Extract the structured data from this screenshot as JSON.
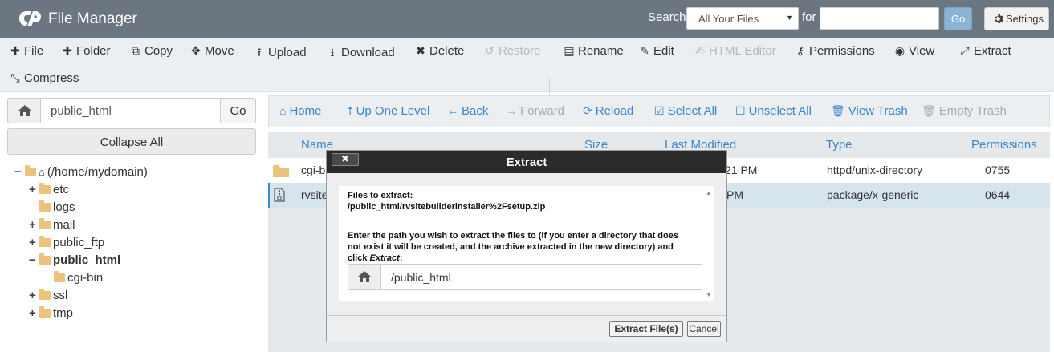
{
  "header": {
    "app_title": "File Manager",
    "search_label": "Search",
    "search_scope": "All Your Files",
    "for_label": "for",
    "search_value": "",
    "go_label": "Go",
    "settings_label": "Settings"
  },
  "toolbar": {
    "file": "File",
    "folder": "Folder",
    "copy": "Copy",
    "move": "Move",
    "upload": "Upload",
    "download": "Download",
    "delete": "Delete",
    "restore": "Restore",
    "rename": "Rename",
    "edit": "Edit",
    "html_editor": "HTML Editor",
    "permissions": "Permissions",
    "view": "View",
    "extract": "Extract",
    "compress": "Compress"
  },
  "sidebar": {
    "path_value": "public_html",
    "go_label": "Go",
    "collapse_label": "Collapse All",
    "tree": [
      {
        "toggle": "−",
        "label": "(/home/mydomain)"
      },
      {
        "toggle": "+",
        "label": "etc"
      },
      {
        "toggle": "",
        "label": "logs"
      },
      {
        "toggle": "+",
        "label": "mail"
      },
      {
        "toggle": "+",
        "label": "public_ftp"
      },
      {
        "toggle": "−",
        "label": "public_html"
      },
      {
        "toggle": "",
        "label": "cgi-bin"
      },
      {
        "toggle": "+",
        "label": "ssl"
      },
      {
        "toggle": "+",
        "label": "tmp"
      }
    ]
  },
  "nav": {
    "home": "Home",
    "up": "Up One Level",
    "back": "Back",
    "forward": "Forward",
    "reload": "Reload",
    "select_all": "Select All",
    "unselect_all": "Unselect All",
    "view_trash": "View Trash",
    "empty_trash": "Empty Trash"
  },
  "table": {
    "headers": {
      "name": "Name",
      "size": "Size",
      "modified": "Last Modified",
      "type": "Type",
      "perms": "Permissions"
    },
    "rows": [
      {
        "name": "cgi-b",
        "modified": "21 PM",
        "type": "httpd/unix-directory",
        "perms": "0755"
      },
      {
        "name": "rvsite",
        "modified": "PM",
        "type": "package/x-generic",
        "perms": "0644"
      }
    ]
  },
  "modal": {
    "title": "Extract",
    "close_label": "✖",
    "files_label": "Files to extract:",
    "file_path": "/public_html/rvsitebuilderinstaller%2Fsetup.zip",
    "instructions": "Enter the path you wish to extract the files to (if you enter a directory that does not exist it will be created, and the archive extracted in the new directory) and click ",
    "instructions_em": "Extract",
    "instructions_end": ":",
    "extract_path": "/public_html",
    "extract_button": "Extract File(s)",
    "cancel_button": "Cancel"
  }
}
